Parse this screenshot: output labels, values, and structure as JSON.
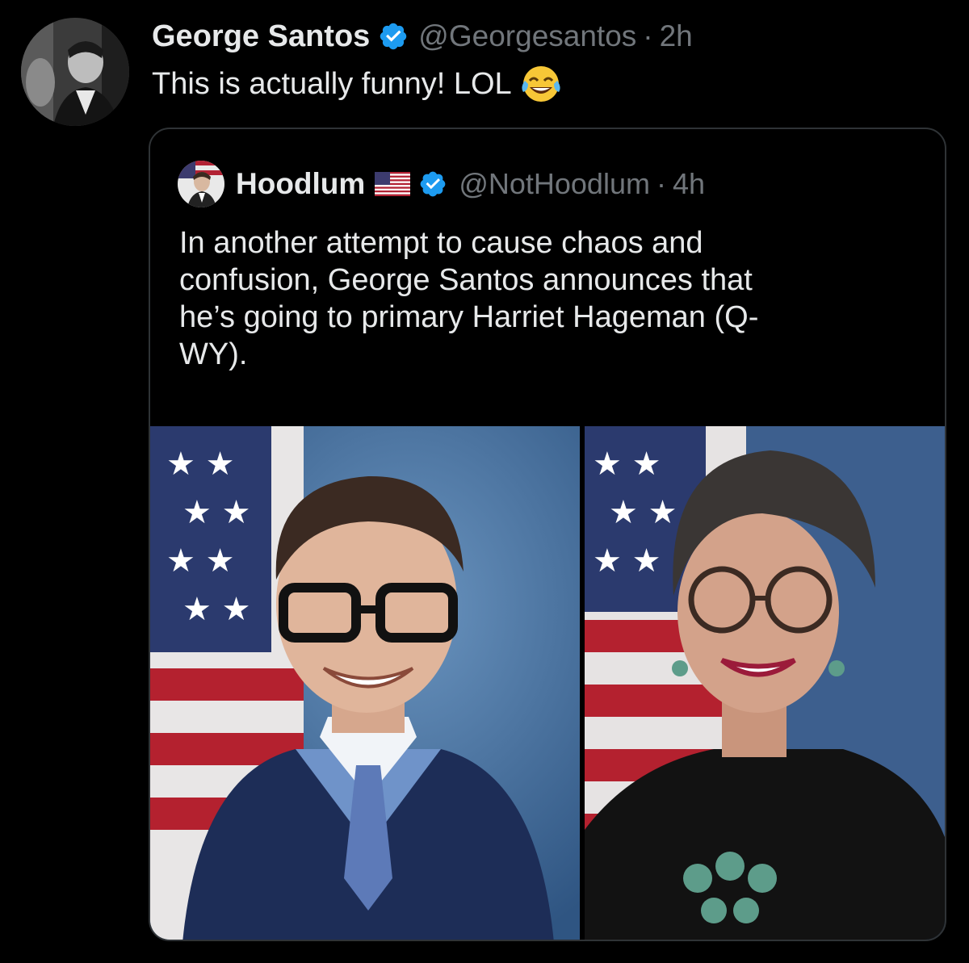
{
  "tweet": {
    "display_name": "George Santos",
    "handle": "@Georgesantos",
    "separator": "·",
    "time": "2h",
    "text": "This is actually funny! LOL",
    "emoji": "face-with-tears-of-joy-icon"
  },
  "quote": {
    "display_name": "Hoodlum",
    "flag": "us-flag-icon",
    "handle": "@NotHoodlum",
    "separator": "·",
    "time": "4h",
    "text_lines": [
      "In another attempt to cause chaos and",
      "confusion, George Santos announces that",
      "he’s going to primary Harriet Hageman (Q-",
      "WY)."
    ]
  },
  "colors": {
    "background": "#000000",
    "text_primary": "#e7e9ea",
    "text_secondary": "#71767b",
    "verified_blue": "#1d9bf0",
    "border": "#2f3336"
  }
}
